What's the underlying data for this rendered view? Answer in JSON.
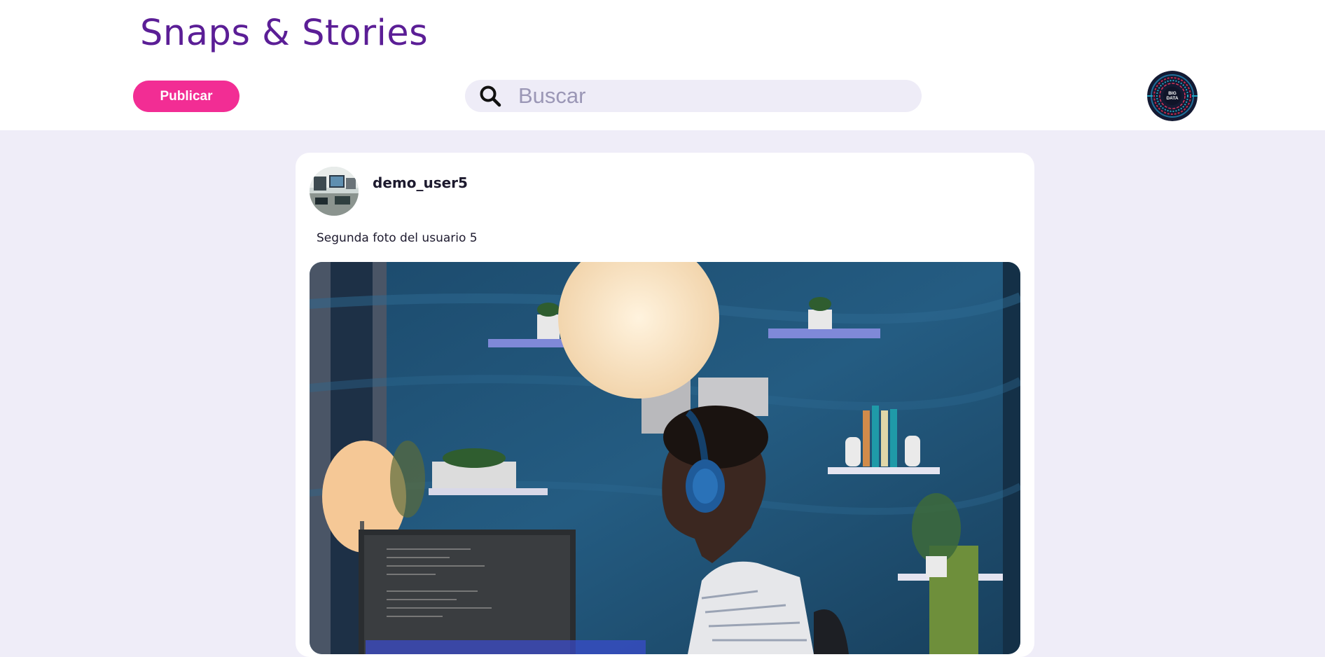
{
  "header": {
    "brand": "Snaps & Stories",
    "publish_label": "Publicar",
    "search": {
      "placeholder": "Buscar",
      "value": ""
    },
    "avatar_text": "BIG DATA"
  },
  "post": {
    "username": "demo_user5",
    "caption": "Segunda foto del usuario 5"
  },
  "colors": {
    "brand": "#5b1e96",
    "accent": "#f22d94",
    "background": "#efedf8"
  }
}
